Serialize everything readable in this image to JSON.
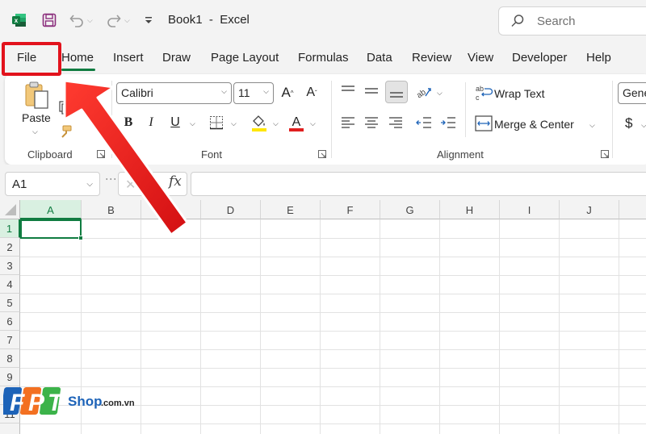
{
  "titlebar": {
    "doc_title": "Book1  -  Excel",
    "search_placeholder": "Search"
  },
  "tabs": [
    {
      "label": "File"
    },
    {
      "label": "Home"
    },
    {
      "label": "Insert"
    },
    {
      "label": "Draw"
    },
    {
      "label": "Page Layout"
    },
    {
      "label": "Formulas"
    },
    {
      "label": "Data"
    },
    {
      "label": "Review"
    },
    {
      "label": "View"
    },
    {
      "label": "Developer"
    },
    {
      "label": "Help"
    }
  ],
  "active_tab": "Home",
  "ribbon": {
    "clipboard": {
      "paste_label": "Paste",
      "group_label": "Clipboard"
    },
    "font": {
      "font_name": "Calibri",
      "font_size": "11",
      "group_label": "Font"
    },
    "alignment": {
      "wrap_text_label": "Wrap Text",
      "merge_center_label": "Merge & Center",
      "group_label": "Alignment"
    },
    "number": {
      "format_partial": "Gene",
      "currency_symbol": "$"
    }
  },
  "formula_bar": {
    "name_box": "A1",
    "fx_label": "fx",
    "formula": ""
  },
  "grid": {
    "columns": [
      "A",
      "B",
      "C",
      "D",
      "E",
      "F",
      "G",
      "H",
      "I",
      "J"
    ],
    "rows": [
      "1",
      "2",
      "3",
      "4",
      "5",
      "6",
      "7",
      "8",
      "9",
      "10",
      "11"
    ],
    "active_cell": "A1"
  },
  "watermark": {
    "brand_letters": "FPT",
    "brand_word": "Shop",
    "domain": ".com.vn"
  },
  "colors": {
    "excel_green": "#107c41",
    "highlight_red": "#e2121c",
    "fill_yellow": "#ffe600",
    "font_red": "#e01f1f",
    "fpt_blue": "#1d63b8",
    "fpt_orange": "#f37021",
    "fpt_green": "#3cb34a"
  }
}
